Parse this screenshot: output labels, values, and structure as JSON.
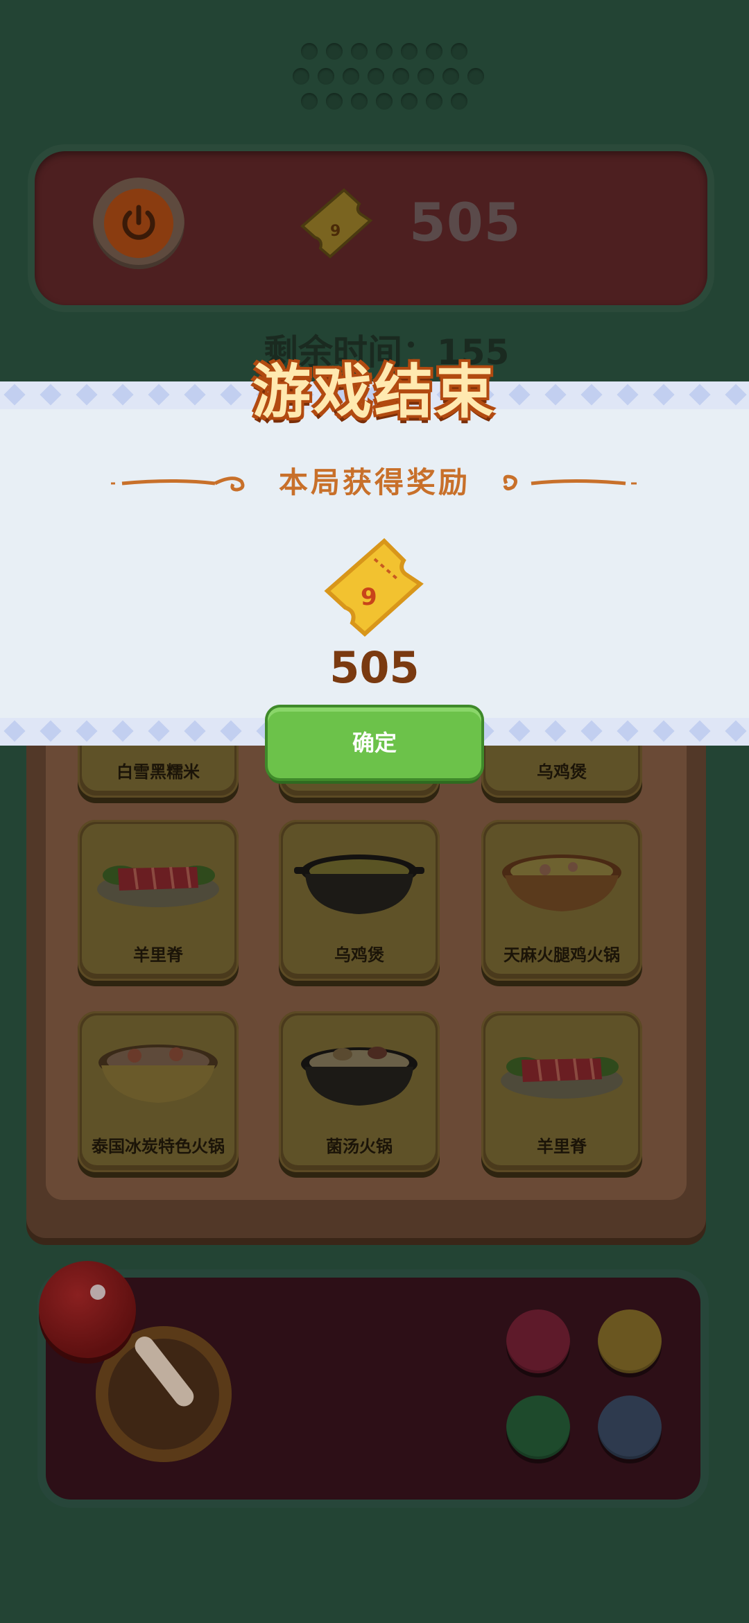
{
  "top_bar": {
    "score": "505",
    "timer_label": "剩余时间：155"
  },
  "board": {
    "rows": [
      [
        "白雪黑糯米",
        "",
        "乌鸡煲"
      ],
      [
        "羊里脊",
        "乌鸡煲",
        "天麻火腿鸡火锅"
      ],
      [
        "泰国冰炭特色火锅",
        "菌汤火锅",
        "羊里脊"
      ]
    ]
  },
  "modal": {
    "title": "游戏结束",
    "reward_header": "本局获得奖励",
    "reward_amount": "505",
    "confirm_label": "确定"
  },
  "icons": {
    "power": "power-icon",
    "ticket": "ticket-icon",
    "joystick": "joystick-icon"
  },
  "colors": {
    "background": "#234434",
    "title_fill": "#ffe9b0",
    "title_outline": "#b24a10",
    "confirm_green": "#6cc24a",
    "reward_text": "#7a3a10",
    "button_red": "#5e1a2a",
    "button_yellow": "#6a5620",
    "button_green": "#1e4a2c",
    "button_blue": "#2e3a4e"
  }
}
